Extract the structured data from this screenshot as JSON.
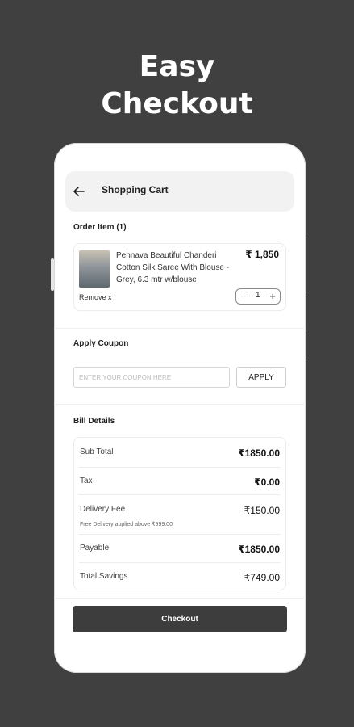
{
  "promo": {
    "line1": "Easy",
    "line2": "Checkout"
  },
  "header": {
    "title": "Shopping Cart"
  },
  "order": {
    "label": "Order Item (1)",
    "item": {
      "name": "Pehnava Beautiful Chanderi Cotton Silk Saree With Blouse - Grey, 6.3 mtr w/blouse",
      "price": "₹ 1,850",
      "remove": "Remove x",
      "quantity": "1"
    }
  },
  "coupon": {
    "label": "Apply Coupon",
    "placeholder": "ENTER YOUR COUPON HERE",
    "apply": "APPLY"
  },
  "bill": {
    "label": "Bill Details",
    "rows": [
      {
        "label": "Sub Total",
        "value": "₹1850.00"
      },
      {
        "label": "Tax",
        "value": "₹0.00"
      },
      {
        "label": "Delivery Fee",
        "value": "₹150.00",
        "note": "Free Delivery applied above ₹999.00"
      },
      {
        "label": "Payable",
        "value": "₹1850.00"
      },
      {
        "label": "Total Savings",
        "value": "₹749.00"
      }
    ]
  },
  "checkout": {
    "label": "Checkout"
  },
  "colors": {
    "background": "#404040",
    "button": "#3d3d3d"
  },
  "icons": {
    "back": "arrow-left-icon",
    "minus": "minus-icon",
    "plus": "plus-icon"
  }
}
